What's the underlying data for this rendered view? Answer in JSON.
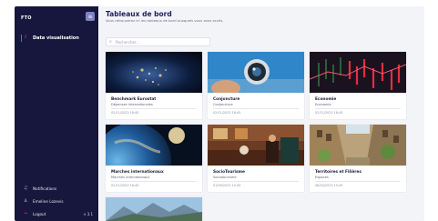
{
  "sidebar": {
    "brand": "FTO",
    "active_item": "Data visualisation",
    "bottom_items": [
      {
        "icon": "bell-icon",
        "label": "Notifications"
      },
      {
        "icon": "user-icon",
        "label": "Emeline Lozevis"
      },
      {
        "icon": "logout-icon",
        "label": "Logout",
        "version": "v 3.1"
      }
    ]
  },
  "header": {
    "title": "Tableaux de bord",
    "subtitle": "Vous retrouverez ici les tableaux de bord auxquels vous avez accès."
  },
  "search": {
    "placeholder": "Rechercher..."
  },
  "cards": [
    {
      "title": "Benchmark Eurostat",
      "subtitle": "Dépenses internationales",
      "date": "02/11/2023 18:40"
    },
    {
      "title": "Conjoncture",
      "subtitle": "Conjoncture",
      "date": "02/11/2023 18:45"
    },
    {
      "title": "Economie",
      "subtitle": "Economie",
      "date": "02/11/2023 18:45"
    },
    {
      "title": "Marches internationaux",
      "subtitle": "Marches internationaux",
      "date": "02/11/2023 18:40"
    },
    {
      "title": "SocioTourisme",
      "subtitle": "Sociotourisme",
      "date": "01/09/2023 15:45"
    },
    {
      "title": "Territoires et Filières",
      "subtitle": "Espaces",
      "date": "06/03/2023 15:45"
    }
  ],
  "colors": {
    "sidebar": "#17163c",
    "accent": "#e23d6b",
    "title": "#1d2158"
  }
}
